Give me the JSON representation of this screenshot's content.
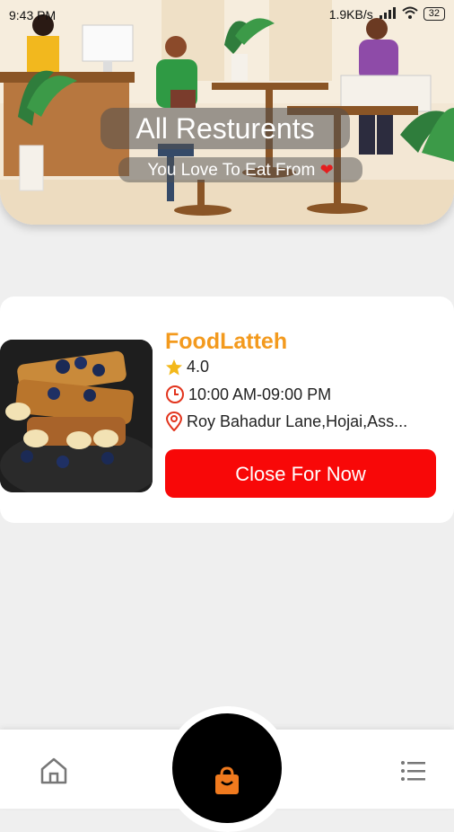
{
  "status_bar": {
    "time": "9:43 PM",
    "network_speed": "1.9KB/s",
    "battery": "32"
  },
  "hero": {
    "title": "All Resturents",
    "subtitle": "You Love To Eat From",
    "heart_icon": "heart-icon"
  },
  "restaurants": [
    {
      "name": "FoodLatteh",
      "rating": "4.0",
      "hours": "10:00 AM-09:00 PM",
      "address": "Roy Bahadur Lane,Hojai,Ass...",
      "button_label": "Close For Now"
    }
  ],
  "nav": {
    "home_icon": "home-icon",
    "center_icon": "shopping-bag-icon",
    "menu_icon": "list-icon"
  },
  "colors": {
    "accent": "#f39a1e",
    "closed_button": "#f80808",
    "heart": "#e41e1e"
  }
}
